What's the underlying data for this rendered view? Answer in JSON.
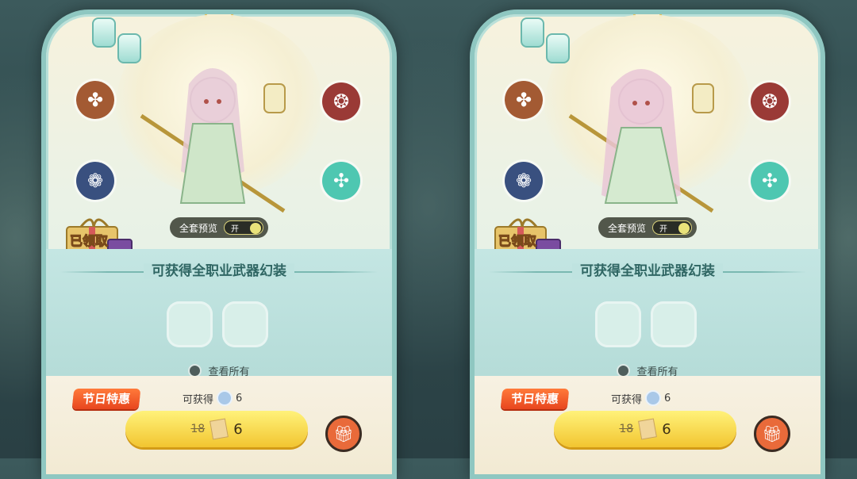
{
  "cards": [
    {
      "preview_label": "全套预览",
      "toggle_label": "开",
      "claimed_label": "已领取",
      "section_title": "可获得全职业武器幻装",
      "view_all_label": "查看所有",
      "promo_label": "节日特惠",
      "obtain_label": "可获得",
      "obtain_count": "6",
      "old_price": "18",
      "new_price": "6"
    },
    {
      "preview_label": "全套预览",
      "toggle_label": "开",
      "claimed_label": "已领取",
      "section_title": "可获得全职业武器幻装",
      "view_all_label": "查看所有",
      "promo_label": "节日特惠",
      "obtain_label": "可获得",
      "obtain_count": "6",
      "old_price": "18",
      "new_price": "6"
    }
  ],
  "colors": {
    "frame": "#8fc7c1",
    "promo": "#e8461e",
    "price_button": "#f2c530"
  },
  "icons": [
    "lantern-icon",
    "brown-emblem-icon",
    "red-emblem-icon",
    "blue-emblem-icon",
    "teal-emblem-icon",
    "gift-box-icon",
    "diamond-icon",
    "ticket-icon",
    "gift-button-icon"
  ]
}
